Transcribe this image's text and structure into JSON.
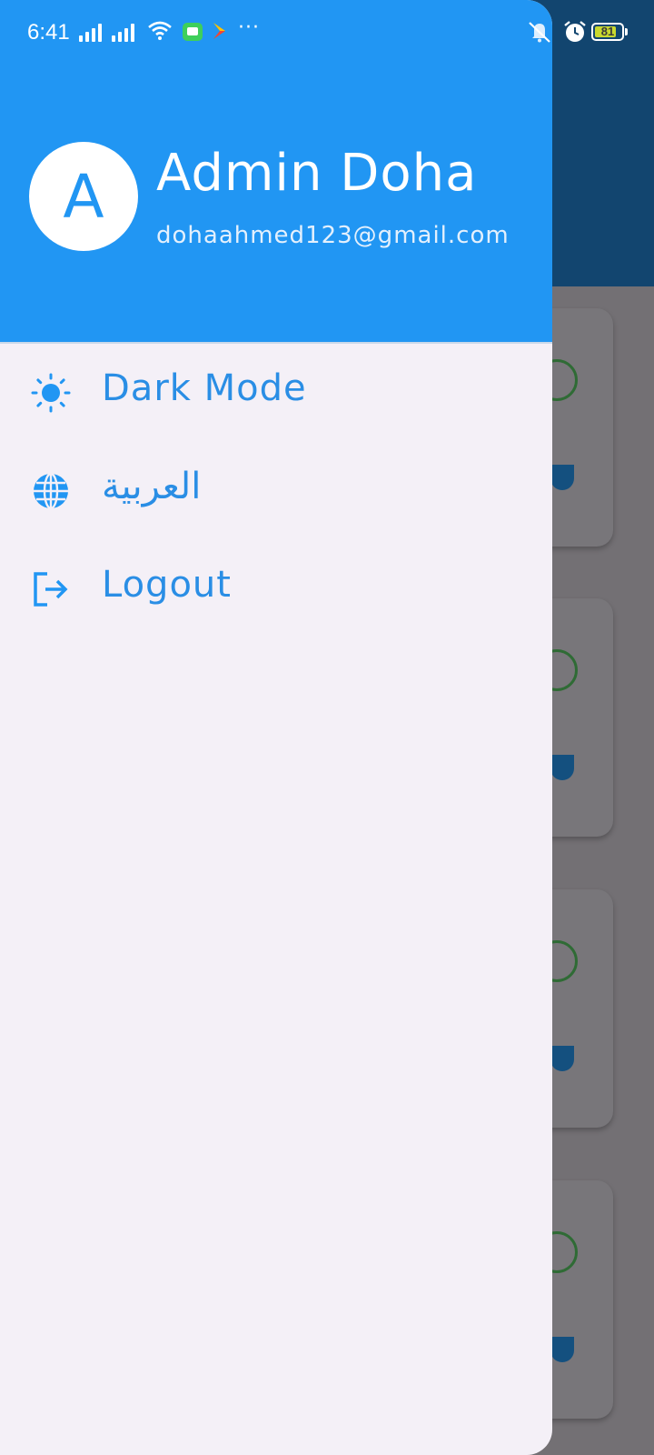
{
  "status_bar": {
    "time": "6:41",
    "more": "···",
    "battery_level": "81",
    "battery_fraction": 0.81
  },
  "drawer": {
    "header": {
      "avatar_letter": "A",
      "name": "Admin Doha",
      "email": "dohaahmed123@gmail.com"
    },
    "items": [
      {
        "label": "Dark Mode",
        "icon": "sun-icon"
      },
      {
        "label": "العربية",
        "icon": "globe-icon"
      },
      {
        "label": "Logout",
        "icon": "logout-icon"
      }
    ]
  },
  "colors": {
    "header_bg": "#2196f3",
    "accent": "#2a8ee5",
    "drawer_bg": "#f4f0f7",
    "background_appbar": "#12456f",
    "scrim": "#737074"
  }
}
